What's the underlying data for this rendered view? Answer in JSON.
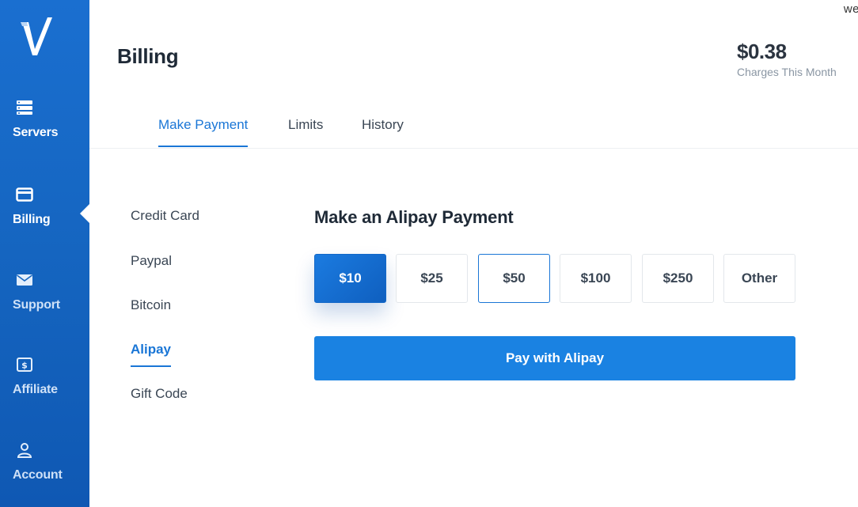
{
  "corner_text": "we",
  "sidebar": {
    "items": [
      {
        "label": "Servers",
        "icon": "server-icon"
      },
      {
        "label": "Billing",
        "icon": "credit-card-icon"
      },
      {
        "label": "Support",
        "icon": "envelope-icon"
      },
      {
        "label": "Affiliate",
        "icon": "dollar-icon"
      },
      {
        "label": "Account",
        "icon": "user-icon"
      }
    ],
    "active": "Billing"
  },
  "header": {
    "title": "Billing",
    "charges_amount": "$0.38",
    "charges_label": "Charges This Month"
  },
  "tabs": [
    {
      "label": "Make Payment",
      "active": true
    },
    {
      "label": "Limits",
      "active": false
    },
    {
      "label": "History",
      "active": false
    }
  ],
  "methods": [
    {
      "label": "Credit Card"
    },
    {
      "label": "Paypal"
    },
    {
      "label": "Bitcoin"
    },
    {
      "label": "Alipay",
      "active": true
    },
    {
      "label": "Gift Code"
    }
  ],
  "payment": {
    "title": "Make an Alipay Payment",
    "amounts": [
      "$10",
      "$25",
      "$50",
      "$100",
      "$250",
      "Other"
    ],
    "selected": "$10",
    "pay_label": "Pay with Alipay"
  },
  "colors": {
    "accent": "#1a76d6",
    "sidebar": "#1565c0",
    "pay_button": "#1a82e2"
  }
}
